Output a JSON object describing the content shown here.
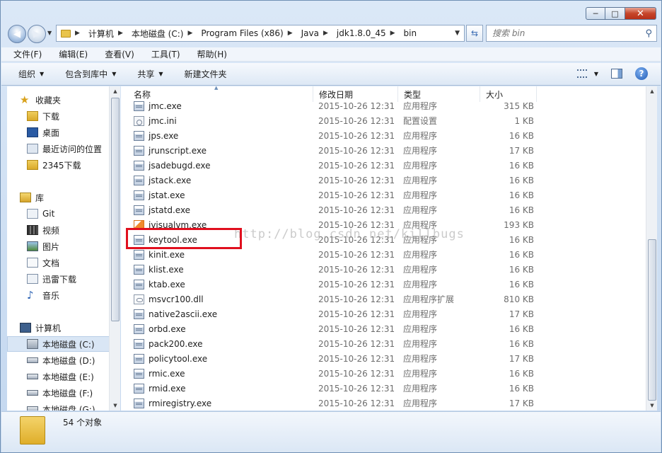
{
  "window": {
    "controls": {
      "minimize": "─",
      "maximize": "□",
      "close": "✕"
    }
  },
  "address": {
    "crumbs": [
      "计算机",
      "本地磁盘 (C:)",
      "Program Files (x86)",
      "Java",
      "jdk1.8.0_45",
      "bin"
    ],
    "search_placeholder": "搜索 bin"
  },
  "menu": [
    "文件(F)",
    "编辑(E)",
    "查看(V)",
    "工具(T)",
    "帮助(H)"
  ],
  "toolbar": {
    "organize": "组织",
    "include": "包含到库中",
    "share": "共享",
    "new_folder": "新建文件夹"
  },
  "sidebar": {
    "favorites": "收藏夹",
    "fav_items": [
      "下载",
      "桌面",
      "最近访问的位置",
      "2345下载"
    ],
    "libraries": "库",
    "lib_items": [
      "Git",
      "视频",
      "图片",
      "文档",
      "迅雷下载",
      "音乐"
    ],
    "computer": "计算机",
    "drives": [
      "本地磁盘 (C:)",
      "本地磁盘 (D:)",
      "本地磁盘 (E:)",
      "本地磁盘 (F:)",
      "本地磁盘 (G:)"
    ]
  },
  "columns": {
    "name": "名称",
    "date": "修改日期",
    "type": "类型",
    "size": "大小"
  },
  "files": [
    {
      "name": "jmc.exe",
      "date": "2015-10-26 12:31",
      "type": "应用程序",
      "size": "315 KB",
      "icon": "exe"
    },
    {
      "name": "jmc.ini",
      "date": "2015-10-26 12:31",
      "type": "配置设置",
      "size": "1 KB",
      "icon": "ini"
    },
    {
      "name": "jps.exe",
      "date": "2015-10-26 12:31",
      "type": "应用程序",
      "size": "16 KB",
      "icon": "exe"
    },
    {
      "name": "jrunscript.exe",
      "date": "2015-10-26 12:31",
      "type": "应用程序",
      "size": "17 KB",
      "icon": "exe"
    },
    {
      "name": "jsadebugd.exe",
      "date": "2015-10-26 12:31",
      "type": "应用程序",
      "size": "16 KB",
      "icon": "exe"
    },
    {
      "name": "jstack.exe",
      "date": "2015-10-26 12:31",
      "type": "应用程序",
      "size": "16 KB",
      "icon": "exe"
    },
    {
      "name": "jstat.exe",
      "date": "2015-10-26 12:31",
      "type": "应用程序",
      "size": "16 KB",
      "icon": "exe"
    },
    {
      "name": "jstatd.exe",
      "date": "2015-10-26 12:31",
      "type": "应用程序",
      "size": "16 KB",
      "icon": "exe"
    },
    {
      "name": "jvisualvm.exe",
      "date": "2015-10-26 12:31",
      "type": "应用程序",
      "size": "193 KB",
      "icon": "jvis"
    },
    {
      "name": "keytool.exe",
      "date": "2015-10-26 12:31",
      "type": "应用程序",
      "size": "16 KB",
      "icon": "exe"
    },
    {
      "name": "kinit.exe",
      "date": "2015-10-26 12:31",
      "type": "应用程序",
      "size": "16 KB",
      "icon": "exe"
    },
    {
      "name": "klist.exe",
      "date": "2015-10-26 12:31",
      "type": "应用程序",
      "size": "16 KB",
      "icon": "exe"
    },
    {
      "name": "ktab.exe",
      "date": "2015-10-26 12:31",
      "type": "应用程序",
      "size": "16 KB",
      "icon": "exe"
    },
    {
      "name": "msvcr100.dll",
      "date": "2015-10-26 12:31",
      "type": "应用程序扩展",
      "size": "810 KB",
      "icon": "dll"
    },
    {
      "name": "native2ascii.exe",
      "date": "2015-10-26 12:31",
      "type": "应用程序",
      "size": "17 KB",
      "icon": "exe"
    },
    {
      "name": "orbd.exe",
      "date": "2015-10-26 12:31",
      "type": "应用程序",
      "size": "16 KB",
      "icon": "exe"
    },
    {
      "name": "pack200.exe",
      "date": "2015-10-26 12:31",
      "type": "应用程序",
      "size": "16 KB",
      "icon": "exe"
    },
    {
      "name": "policytool.exe",
      "date": "2015-10-26 12:31",
      "type": "应用程序",
      "size": "17 KB",
      "icon": "exe"
    },
    {
      "name": "rmic.exe",
      "date": "2015-10-26 12:31",
      "type": "应用程序",
      "size": "16 KB",
      "icon": "exe"
    },
    {
      "name": "rmid.exe",
      "date": "2015-10-26 12:31",
      "type": "应用程序",
      "size": "16 KB",
      "icon": "exe"
    },
    {
      "name": "rmiregistry.exe",
      "date": "2015-10-26 12:31",
      "type": "应用程序",
      "size": "17 KB",
      "icon": "exe"
    }
  ],
  "watermark": "http://blog.csdn.net/killbugs",
  "status": {
    "count": "54 个对象"
  }
}
